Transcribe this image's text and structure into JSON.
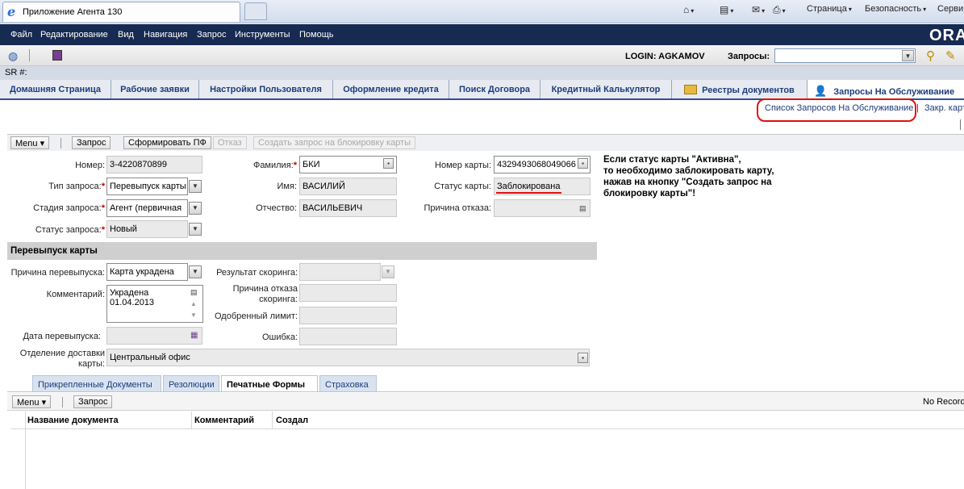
{
  "browser": {
    "tab_title": "Приложение Агента 130",
    "toolbar": {
      "page": "Страница",
      "security": "Безопасность",
      "service": "Серви"
    }
  },
  "menu": {
    "items": [
      "Файл",
      "Редактирование",
      "Вид",
      "Навигация",
      "Запрос",
      "Инструменты",
      "Помощь"
    ],
    "logo": "ORA"
  },
  "toolbar": {
    "login": "LOGIN: AGKAMOV",
    "queries_label": "Запросы:",
    "queries_value": ""
  },
  "sr_label": "SR #:",
  "screen_tabs": [
    "Домашняя Страница",
    "Рабочие заявки",
    "Настройки Пользователя",
    "Оформление кредита",
    "Поиск Договора",
    "Кредитный Калькулятор",
    "Реестры документов",
    "Запросы На Обслуживание"
  ],
  "subviews": {
    "list": "Список Запросов На Обслуживание",
    "sep": "|",
    "closed": "Закр. карт"
  },
  "applet": {
    "menu": "Menu",
    "request": "Запрос",
    "generate": "Сформировать ПФ",
    "cancel": "Отказ",
    "create_block": "Создать запрос на блокировку карты"
  },
  "form": {
    "number_label": "Номер:",
    "number": "3-4220870899",
    "type_label": "Тип запроса:",
    "type": "Перевыпуск карты",
    "stage_label": "Стадия запроса:",
    "stage": "Агент (первичная",
    "status_label": "Статус запроса:",
    "status": "Новый",
    "lastname_label": "Фамилия:",
    "lastname": "БКИ",
    "firstname_label": "Имя:",
    "firstname": "ВАСИЛИЙ",
    "patronymic_label": "Отчество:",
    "patronymic": "ВАСИЛЬЕВИЧ",
    "card_label": "Номер карты:",
    "card": "4329493068049066",
    "card_status_label": "Статус карты:",
    "card_status": "Заблокирована",
    "reason_label": "Причина отказа:",
    "reason": ""
  },
  "note": "Если статус карты \"Активна\",\n то необходимо заблокировать карту,\n нажав на кнопку \"Создать запрос на\n блокировку карты\"!",
  "section": {
    "title": "Перевыпуск карты",
    "reissue_reason_label": "Причина перевыпуска:",
    "reissue_reason": "Карта украдена",
    "comment_label": "Комментарий:",
    "comment": "Украдена\n01.04.2013",
    "reissue_date_label": "Дата перевыпуска:",
    "reissue_date": "",
    "delivery_label": "Отделение доставки карты:",
    "delivery": "Центральный офис",
    "scoring_label": "Результат скоринга:",
    "scoring": "",
    "scoring_refusal_label": "Причина отказа скоринга:",
    "scoring_refusal": "",
    "approved_limit_label": "Одобренный лимит:",
    "approved_limit": "",
    "error_label": "Ошибка:",
    "error": ""
  },
  "bottom_tabs": [
    "Прикрепленные Документы",
    "Резолюции",
    "Печатные Формы",
    "Страховка"
  ],
  "list": {
    "menu": "Menu",
    "request": "Запрос",
    "records": "No Records",
    "columns": [
      "Название документа",
      "Комментарий",
      "Создал"
    ]
  },
  "colors": {
    "menubar": "#162a52",
    "accent": "#2f5097",
    "required": "#c00000",
    "highlight": "#e01010"
  }
}
